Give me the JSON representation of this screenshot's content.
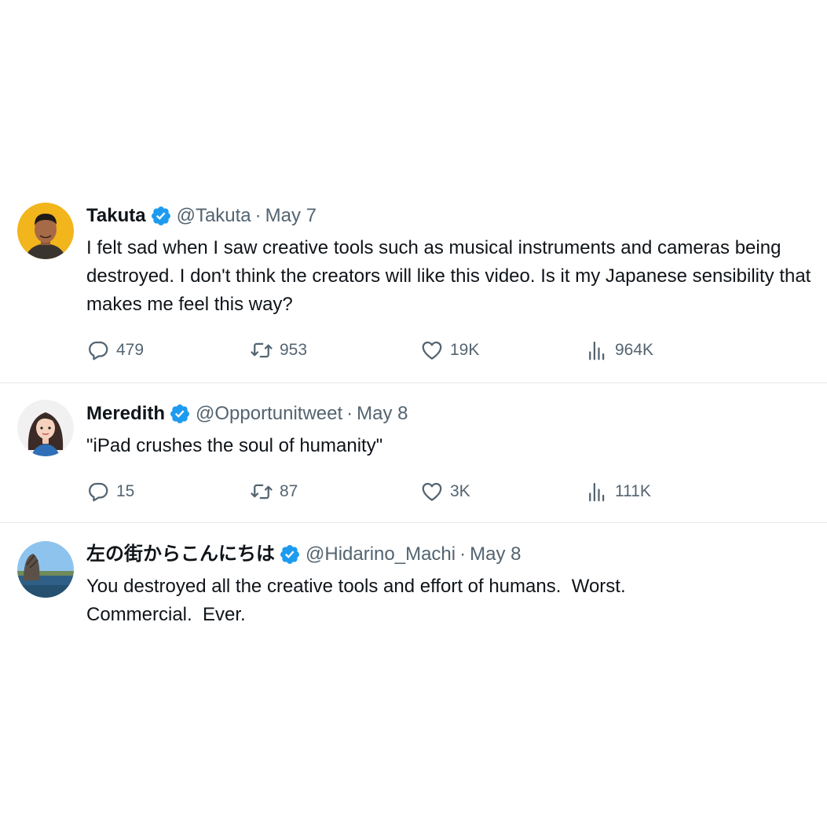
{
  "tweets": [
    {
      "name": "Takuta",
      "handle": "@Takuta",
      "separator": "·",
      "date": "May 7",
      "text": "I felt sad when I saw creative tools such as musical instruments and cameras being destroyed. I don't think the creators will like this video. Is it my Japanese sensibility that makes me feel this way?",
      "replies": "479",
      "retweets": "953",
      "likes": "19K",
      "views": "964K"
    },
    {
      "name": "Meredith",
      "handle": "@Opportunitweet",
      "separator": "·",
      "date": "May 8",
      "text": "\"iPad crushes the soul of humanity\"",
      "replies": "15",
      "retweets": "87",
      "likes": "3K",
      "views": "111K"
    },
    {
      "name": "左の街からこんにちは",
      "handle": "@Hidarino_Machi",
      "separator": "·",
      "date": "May 8",
      "text": "You destroyed all the creative tools and effort of humans.  Worst. Commercial.  Ever."
    }
  ],
  "colors": {
    "verified": "#1d9bf0",
    "muted": "#536471",
    "text": "#0f1419",
    "divider": "#e6e9eb"
  },
  "icons": {
    "reply": "speech-bubble-icon",
    "retweet": "retweet-arrows-icon",
    "like": "heart-icon",
    "views": "bar-chart-icon",
    "verified": "verified-badge-icon"
  }
}
